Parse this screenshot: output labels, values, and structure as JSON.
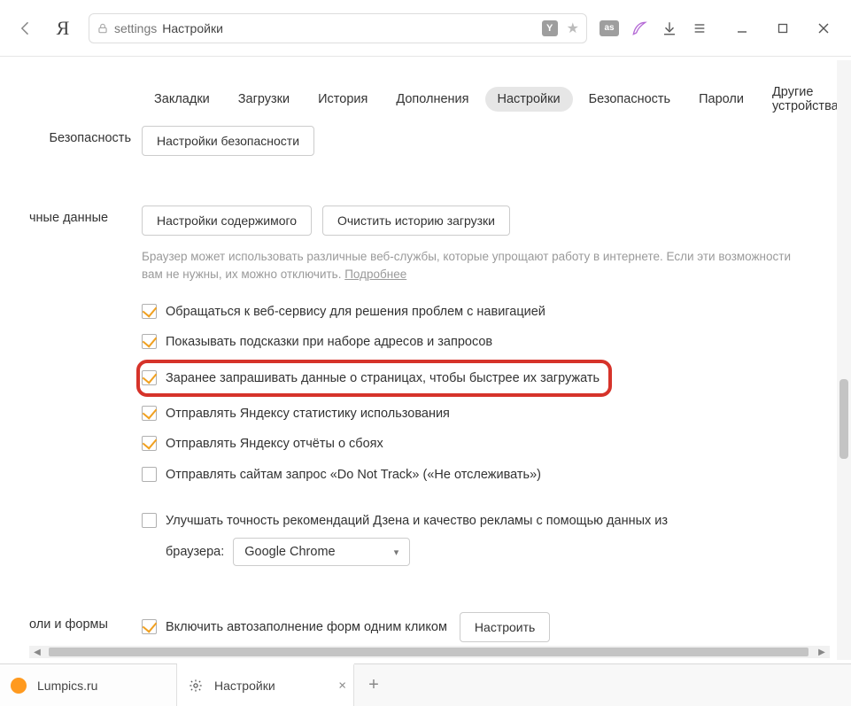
{
  "chrome": {
    "url_keyword": "settings",
    "url_title": "Настройки",
    "y_badge": "Y",
    "lastfm": "as"
  },
  "nav": {
    "tabs": [
      {
        "label": "Закладки"
      },
      {
        "label": "Загрузки"
      },
      {
        "label": "История"
      },
      {
        "label": "Дополнения"
      },
      {
        "label": "Настройки",
        "active": true
      },
      {
        "label": "Безопасность"
      },
      {
        "label": "Пароли"
      },
      {
        "label": "Другие устройства"
      }
    ]
  },
  "sections": {
    "security": {
      "label": "Безопасность",
      "button": "Настройки безопасности"
    },
    "personal": {
      "label": "чные данные",
      "btn_content": "Настройки содержимого",
      "btn_clear": "Очистить историю загрузки",
      "hint_text": "Браузер может использовать различные веб-службы, которые упрощают работу в интернете. Если эти возможности вам не нужны, их можно отключить. ",
      "hint_link": "Подробнее",
      "options": [
        {
          "label": "Обращаться к веб-сервису для решения проблем с навигацией",
          "checked": true
        },
        {
          "label": "Показывать подсказки при наборе адресов и запросов",
          "checked": true
        },
        {
          "label": "Заранее запрашивать данные о страницах, чтобы быстрее их загружать",
          "checked": true,
          "highlight": true
        },
        {
          "label": "Отправлять Яндексу статистику использования",
          "checked": true
        },
        {
          "label": "Отправлять Яндексу отчёты о сбоях",
          "checked": true
        },
        {
          "label": "Отправлять сайтам запрос «Do Not Track» («Не отслеживать»)",
          "checked": false
        },
        {
          "label": "Улучшать точность рекомендаций Дзена и качество рекламы с помощью данных из",
          "checked": false
        }
      ],
      "browser_label": "браузера:",
      "browser_value": "Google Chrome"
    },
    "forms": {
      "label": "оли и формы",
      "option": {
        "label": "Включить автозаполнение форм одним кликом",
        "checked": true
      },
      "config_btn": "Настроить"
    }
  },
  "bottomtabs": {
    "items": [
      {
        "title": "Lumpics.ru",
        "favicon": "orange"
      },
      {
        "title": "Настройки",
        "favicon": "gear",
        "active": true,
        "closable": true
      }
    ]
  }
}
